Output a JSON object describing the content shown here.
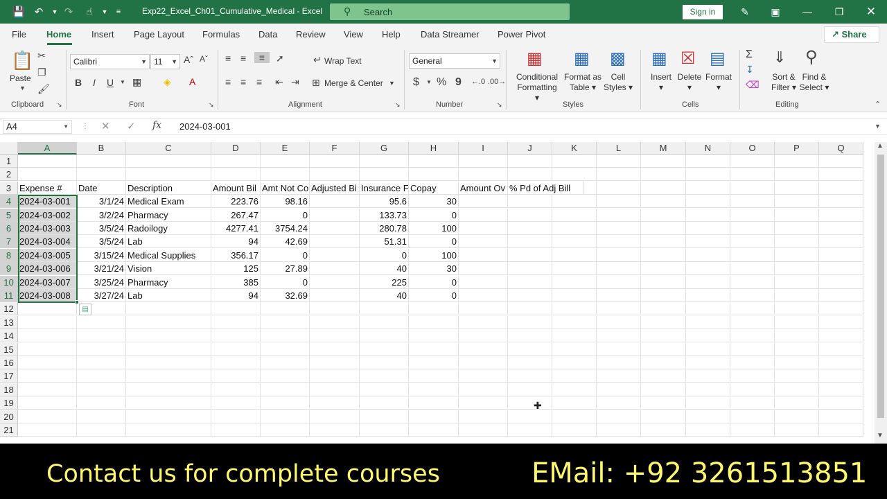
{
  "window": {
    "doc_title": "Exp22_Excel_Ch01_Cumulative_Medical  -  Excel",
    "search_placeholder": "Search",
    "signin_label": "Sign in"
  },
  "menu": {
    "tabs": [
      "File",
      "Home",
      "Insert",
      "Page Layout",
      "Formulas",
      "Data",
      "Review",
      "View",
      "Help",
      "Data Streamer",
      "Power Pivot"
    ],
    "active_tab": "Home",
    "share_label": "Share"
  },
  "ribbon": {
    "clipboard": {
      "paste_label": "Paste",
      "group_label": "Clipboard"
    },
    "font": {
      "font_name": "Calibri",
      "font_size": "11",
      "bold": "B",
      "italic": "I",
      "underline": "U",
      "group_label": "Font"
    },
    "alignment": {
      "wrap_text": "Wrap Text",
      "merge_center": "Merge & Center",
      "group_label": "Alignment"
    },
    "number": {
      "format": "General",
      "currency": "$",
      "percent": "%",
      "comma": "9",
      "group_label": "Number"
    },
    "styles": {
      "conditional_formatting_1": "Conditional",
      "conditional_formatting_2": "Formatting",
      "format_as_table_1": "Format as",
      "format_as_table_2": "Table",
      "cell_styles_1": "Cell",
      "cell_styles_2": "Styles",
      "group_label": "Styles"
    },
    "cells": {
      "insert": "Insert",
      "delete": "Delete",
      "format": "Format",
      "group_label": "Cells"
    },
    "editing": {
      "sort_filter_1": "Sort &",
      "sort_filter_2": "Filter",
      "find_select_1": "Find &",
      "find_select_2": "Select",
      "group_label": "Editing"
    }
  },
  "formula_bar": {
    "name_box": "A4",
    "fx_label": "fx",
    "value": "2024-03-001"
  },
  "sheet": {
    "columns": [
      "A",
      "B",
      "C",
      "D",
      "E",
      "F",
      "G",
      "H",
      "I",
      "J",
      "K",
      "L",
      "M",
      "N",
      "O",
      "P",
      "Q"
    ],
    "row_numbers": [
      "1",
      "2",
      "3",
      "4",
      "5",
      "6",
      "7",
      "8",
      "9",
      "10",
      "11",
      "12",
      "13",
      "14",
      "15",
      "16",
      "17",
      "18",
      "19",
      "20",
      "21"
    ],
    "headers": [
      "Expense #",
      "Date",
      "Description",
      "Amount Bil",
      "Amt Not Co",
      "Adjusted Bi",
      "Insurance F",
      "Copay",
      "Amount Ov",
      "% Pd of Adj Bill"
    ],
    "rows": [
      [
        "2024-03-001",
        "3/1/24",
        "Medical Exam",
        "223.76",
        "98.16",
        "",
        "95.6",
        "30"
      ],
      [
        "2024-03-002",
        "3/2/24",
        "Pharmacy",
        "267.47",
        "0",
        "",
        "133.73",
        "0"
      ],
      [
        "2024-03-003",
        "3/5/24",
        "Radoilogy",
        "4277.41",
        "3754.24",
        "",
        "280.78",
        "100"
      ],
      [
        "2024-03-004",
        "3/5/24",
        "Lab",
        "94",
        "42.69",
        "",
        "51.31",
        "0"
      ],
      [
        "2024-03-005",
        "3/15/24",
        "Medical Supplies",
        "356.17",
        "0",
        "",
        "0",
        "100"
      ],
      [
        "2024-03-006",
        "3/21/24",
        "Vision",
        "125",
        "27.89",
        "",
        "40",
        "30"
      ],
      [
        "2024-03-007",
        "3/25/24",
        "Pharmacy",
        "385",
        "0",
        "",
        "225",
        "0"
      ],
      [
        "2024-03-008",
        "3/27/24",
        "Lab",
        "94",
        "32.69",
        "",
        "40",
        "0"
      ]
    ]
  },
  "banner": {
    "left_text": "Contact us for complete courses",
    "right_text": "EMail: +92 3261513851"
  }
}
